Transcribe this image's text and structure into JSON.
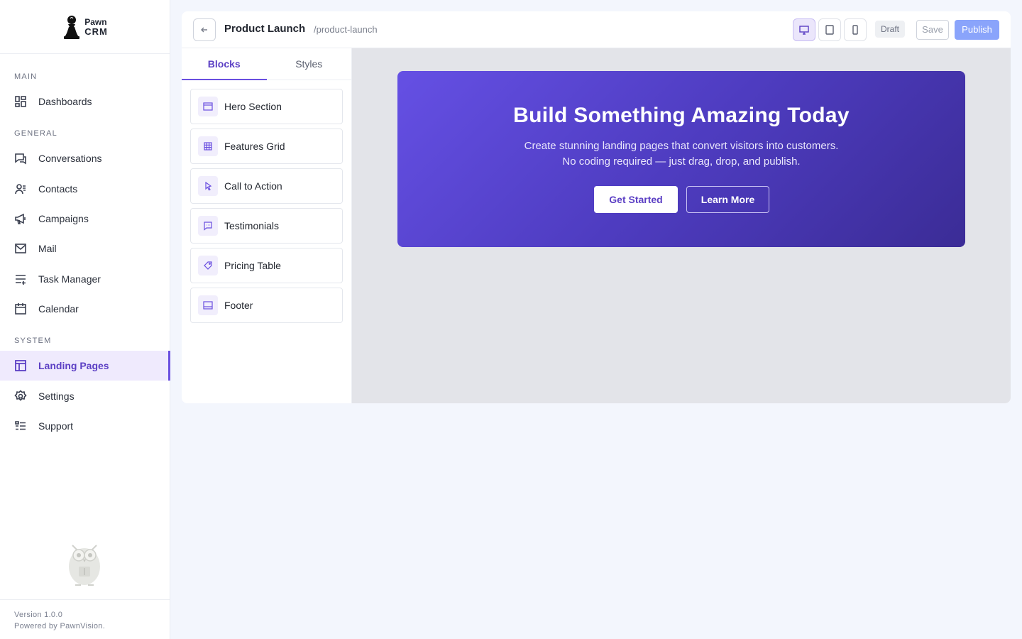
{
  "brand": {
    "line1": "Pawn",
    "line2": "CRM"
  },
  "sidebar": {
    "sections": [
      {
        "label": "MAIN"
      },
      {
        "label": "GENERAL"
      },
      {
        "label": "SYSTEM"
      }
    ],
    "items": [
      {
        "label": "Dashboards",
        "icon": "dashboard-icon"
      },
      {
        "label": "Conversations",
        "icon": "chat-icon"
      },
      {
        "label": "Contacts",
        "icon": "contacts-icon"
      },
      {
        "label": "Campaigns",
        "icon": "megaphone-icon"
      },
      {
        "label": "Mail",
        "icon": "mail-icon"
      },
      {
        "label": "Task Manager",
        "icon": "tasks-icon"
      },
      {
        "label": "Calendar",
        "icon": "calendar-icon"
      },
      {
        "label": "Landing Pages",
        "icon": "layout-icon",
        "active": true
      },
      {
        "label": "Settings",
        "icon": "gear-icon"
      },
      {
        "label": "Support",
        "icon": "support-icon"
      }
    ],
    "footer": {
      "version": "Version 1.0.0",
      "powered": "Powered by PawnVision."
    }
  },
  "editor": {
    "title": "Product Launch",
    "slug": "/product-launch",
    "status": "Draft",
    "save_label": "Save",
    "publish_label": "Publish",
    "devices": [
      "desktop-icon",
      "tablet-icon",
      "mobile-icon"
    ],
    "tabs": [
      {
        "label": "Blocks",
        "active": true
      },
      {
        "label": "Styles"
      }
    ],
    "blocks": [
      {
        "label": "Hero Section",
        "icon": "hero-icon"
      },
      {
        "label": "Features Grid",
        "icon": "grid-icon"
      },
      {
        "label": "Call to Action",
        "icon": "pointer-icon"
      },
      {
        "label": "Testimonials",
        "icon": "quote-icon"
      },
      {
        "label": "Pricing Table",
        "icon": "tag-icon"
      },
      {
        "label": "Footer",
        "icon": "footer-icon"
      }
    ]
  },
  "hero": {
    "title": "Build Something Amazing Today",
    "subtitle_line1": "Create stunning landing pages that convert visitors into customers.",
    "subtitle_line2": "No coding required — just drag, drop, and publish.",
    "primary_cta": "Get Started",
    "secondary_cta": "Learn More"
  },
  "colors": {
    "accent": "#6a4fe0",
    "hero_start": "#6550e4",
    "hero_end": "#3b2c96",
    "publish": "#8aa4fb"
  }
}
